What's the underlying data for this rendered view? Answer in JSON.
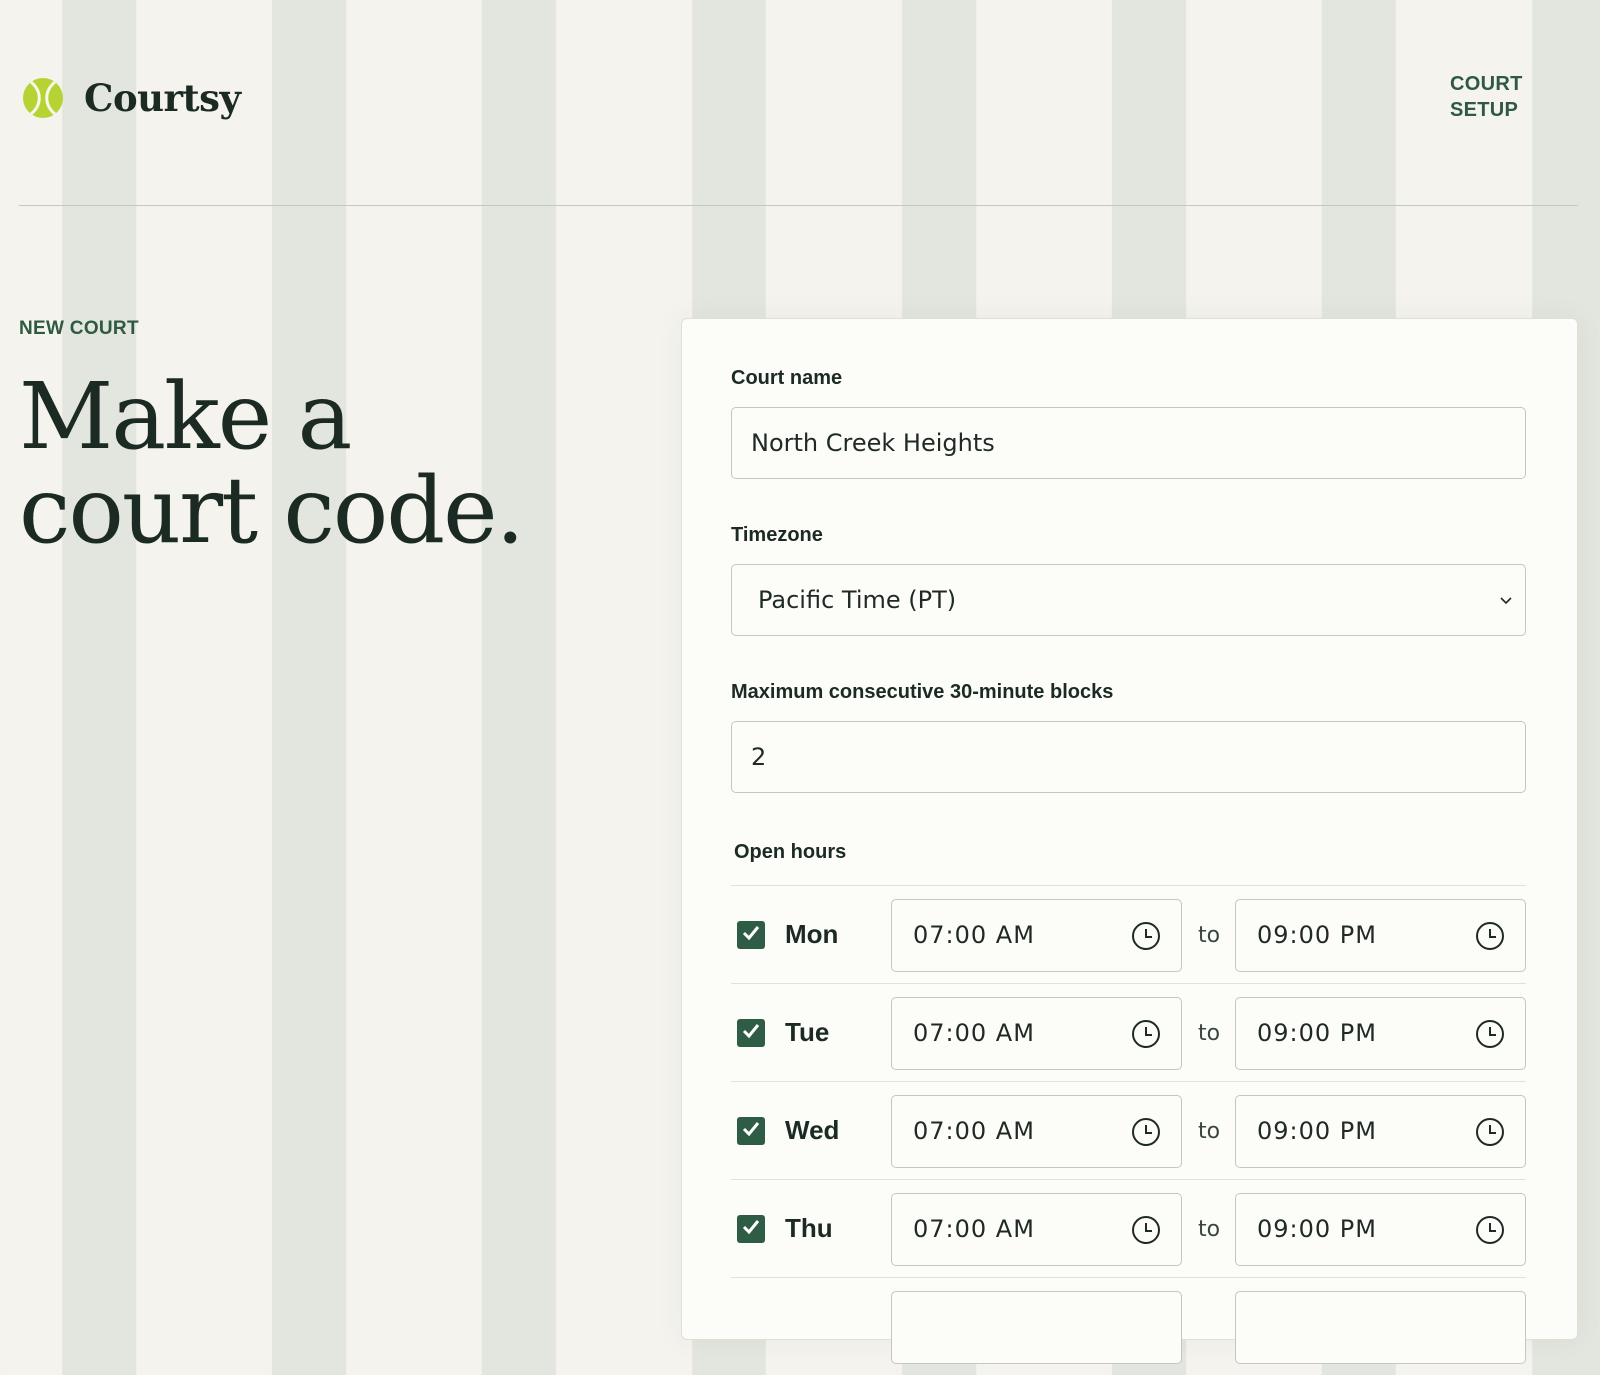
{
  "brand": {
    "name": "Courtsy",
    "logo_icon": "tennis-ball-icon",
    "logo_color": "#b6d336"
  },
  "nav": {
    "link_label": "COURT SETUP"
  },
  "hero": {
    "eyebrow": "NEW COURT",
    "title": "Make a court code."
  },
  "form": {
    "court_name": {
      "label": "Court name",
      "value": "North Creek Heights"
    },
    "timezone": {
      "label": "Timezone",
      "value": "Pacific Time (PT)"
    },
    "max_blocks": {
      "label": "Maximum consecutive 30-minute blocks",
      "value": "2"
    },
    "open_hours": {
      "label": "Open hours",
      "separator": "to",
      "days": [
        {
          "day": "Mon",
          "checked": true,
          "open": "07:00 AM",
          "close": "09:00 PM"
        },
        {
          "day": "Tue",
          "checked": true,
          "open": "07:00 AM",
          "close": "09:00 PM"
        },
        {
          "day": "Wed",
          "checked": true,
          "open": "07:00 AM",
          "close": "09:00 PM"
        },
        {
          "day": "Thu",
          "checked": true,
          "open": "07:00 AM",
          "close": "09:00 PM"
        }
      ]
    }
  },
  "colors": {
    "accent": "#2e5c44",
    "text": "#1b2a22",
    "stripe": "#e3e6de",
    "background": "#f5f3ee"
  }
}
